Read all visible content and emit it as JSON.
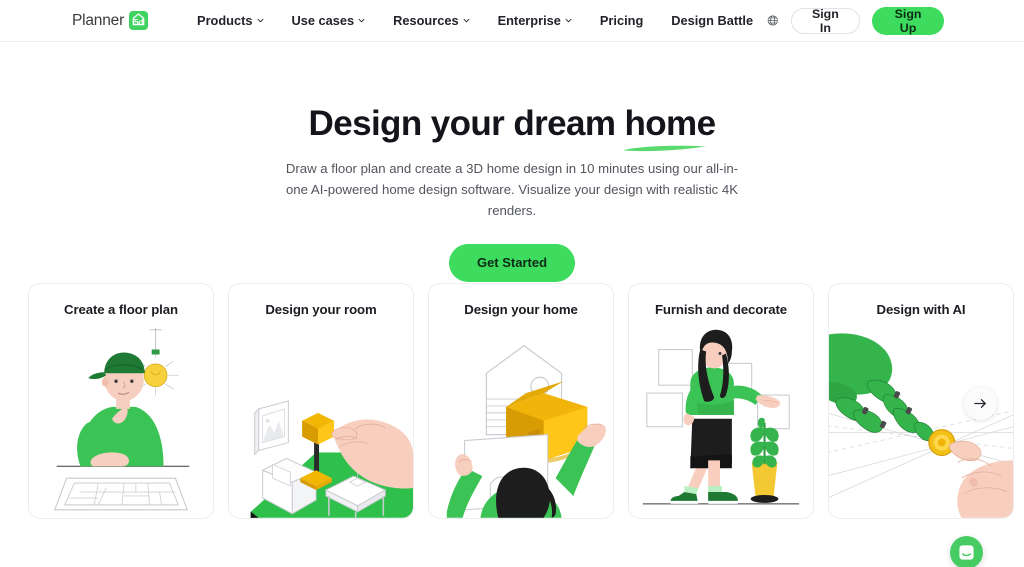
{
  "header": {
    "logo": {
      "text": "Planner",
      "mark_label": "5d",
      "mark_icon": "house-icon",
      "color": "#3ed35f"
    },
    "nav": [
      {
        "label": "Products",
        "has_caret": true
      },
      {
        "label": "Use cases",
        "has_caret": true
      },
      {
        "label": "Resources",
        "has_caret": true
      },
      {
        "label": "Enterprise",
        "has_caret": true
      },
      {
        "label": "Pricing",
        "has_caret": false
      },
      {
        "label": "Design Battle",
        "has_caret": false
      }
    ],
    "language_icon": "globe-icon",
    "sign_in_label": "Sign In",
    "sign_up_label": "Sign Up"
  },
  "hero": {
    "title_lead": "Design your dream ",
    "title_highlight": "home",
    "subtitle": "Draw a floor plan and create a 3D home design in 10 minutes using our all-in-one AI-powered home design software. Visualize your design with realistic 4K renders.",
    "cta_label": "Get Started",
    "accent_color": "#3ddc5f"
  },
  "cards": [
    {
      "title": "Create a floor plan",
      "art": "person-at-desk-with-floorplan"
    },
    {
      "title": "Design your room",
      "art": "hand-placing-lamp-isometric-room"
    },
    {
      "title": "Design your home",
      "art": "woman-holding-house-model"
    },
    {
      "title": "Furnish and decorate",
      "art": "woman-hanging-picture-frames"
    },
    {
      "title": "Design with AI",
      "art": "robot-hand-touching-human-hand"
    }
  ],
  "controls": {
    "carousel_next_icon": "arrow-right-icon",
    "chat_icon": "chat-bubble-icon"
  }
}
